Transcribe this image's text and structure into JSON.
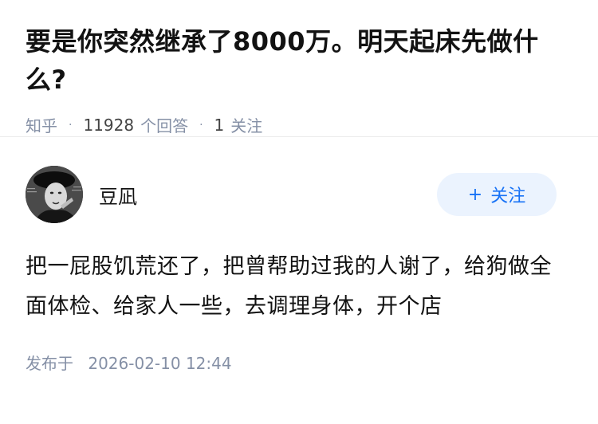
{
  "question": {
    "title": "要是你突然继承了8000万。明天起床先做什么?",
    "source": "知乎",
    "answer_count": "11928",
    "answer_unit": "个回答",
    "follower_count": "1",
    "follower_unit": "关注"
  },
  "answer": {
    "author_name": "豆凪",
    "follow_label": "关注",
    "content": "把一屁股饥荒还了，把曾帮助过我的人谢了，给狗做全面体检、给家人一些，去调理身体，开个店",
    "published_label": "发布于",
    "published_time": "2026-02-10 12:44"
  },
  "colors": {
    "accent": "#1772f6",
    "button_bg": "#ebf3fe",
    "meta_gray": "#8590a6"
  }
}
